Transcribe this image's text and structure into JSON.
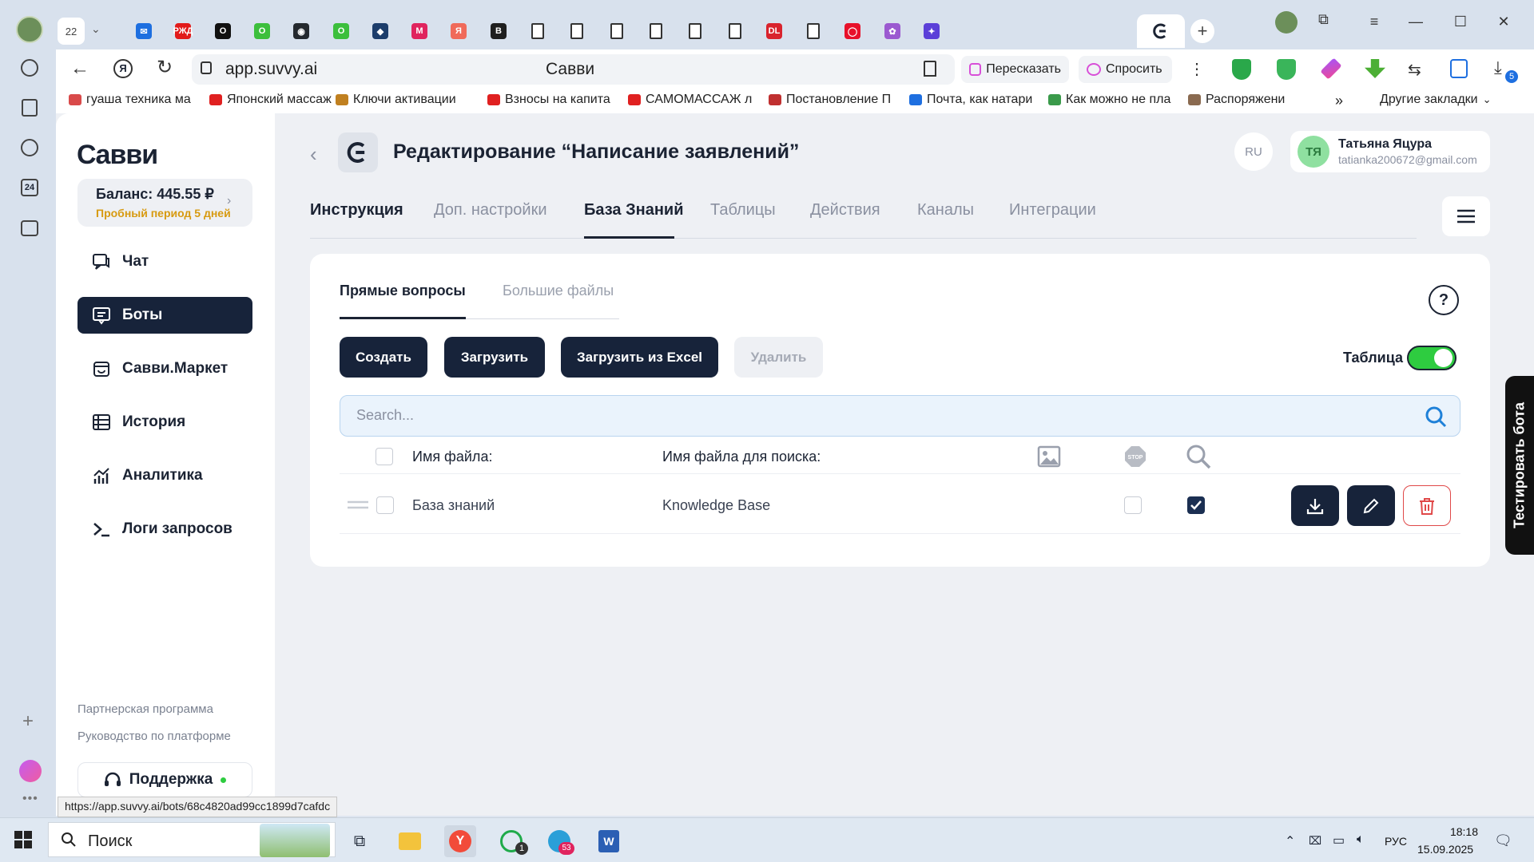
{
  "browser": {
    "tab_count": "22",
    "url": "app.suvvy.ai",
    "page_title": "Савви",
    "retell_label": "Пересказать",
    "ask_label": "Спросить",
    "download_badge": "5",
    "status_url": "https://app.suvvy.ai/bots/68c4820ad99cc1899d7cafdc",
    "bookmarks": [
      "гуаша техника ма",
      "Японский массаж",
      "Ключи активации",
      "Взносы на капита",
      "САМОМАССАЖ л",
      "Постановление П",
      "Почта, как натари",
      "Как можно не пла",
      "Распоряжени"
    ],
    "other_bookmarks": "Другие закладки",
    "tab_icons": [
      {
        "name": "mail",
        "color": "#1e6fe0",
        "glyph": "✉"
      },
      {
        "name": "rzd",
        "color": "#e21a1a",
        "glyph": "РЖД"
      },
      {
        "name": "o-dark",
        "color": "#111111",
        "glyph": "O"
      },
      {
        "name": "o-green",
        "color": "#3cbf3c",
        "glyph": "O"
      },
      {
        "name": "github",
        "color": "#24292e",
        "glyph": "◉"
      },
      {
        "name": "o-green2",
        "color": "#3cbf3c",
        "glyph": "O"
      },
      {
        "name": "game",
        "color": "#1c3d6b",
        "glyph": "◆"
      },
      {
        "name": "m-red",
        "color": "#e0245e",
        "glyph": "M"
      },
      {
        "name": "yandex-tab",
        "color": "#f06a5a",
        "glyph": "Я"
      },
      {
        "name": "b-tab",
        "color": "#1f1f1f",
        "glyph": "B"
      },
      {
        "name": "doc1",
        "color": "#ffffff",
        "glyph": ""
      },
      {
        "name": "doc2",
        "color": "#ffffff",
        "glyph": ""
      },
      {
        "name": "doc3",
        "color": "#ffffff",
        "glyph": ""
      },
      {
        "name": "doc4",
        "color": "#ffffff",
        "glyph": ""
      },
      {
        "name": "doc5",
        "color": "#ffffff",
        "glyph": ""
      },
      {
        "name": "doc6",
        "color": "#ffffff",
        "glyph": ""
      },
      {
        "name": "dl",
        "color": "#d9232d",
        "glyph": "DL"
      },
      {
        "name": "doc7",
        "color": "#ffffff",
        "glyph": ""
      },
      {
        "name": "opera",
        "color": "#e8102a",
        "glyph": "◯"
      },
      {
        "name": "figma",
        "color": "#9b59d0",
        "glyph": "✿"
      },
      {
        "name": "star",
        "color": "#5b3fd8",
        "glyph": "✦"
      }
    ]
  },
  "app": {
    "logo": "Cавви",
    "balance": "Баланс: 445.55 ₽",
    "trial": "Пробный период 5 дней",
    "nav": [
      "Чат",
      "Боты",
      "Савви.Маркет",
      "История",
      "Аналитика",
      "Логи запросов"
    ],
    "partner_link": "Партнерская программа",
    "guide_link": "Руководство по платформе",
    "support": "Поддержка",
    "title": "Редактирование “Написание заявлений”",
    "lang": "RU",
    "user": {
      "initials": "ТЯ",
      "name": "Татьяна Яцура",
      "email": "tatianka200672@gmail.com"
    },
    "main_tabs": [
      "Инструкция",
      "Доп. настройки",
      "База Знаний",
      "Таблицы",
      "Действия",
      "Каналы",
      "Интеграции"
    ],
    "sub_tabs": [
      "Прямые вопросы",
      "Большие файлы"
    ],
    "help": "?",
    "buttons": {
      "create": "Создать",
      "upload": "Загрузить",
      "upload_excel": "Загрузить из Excel",
      "delete": "Удалить"
    },
    "table_toggle_label": "Таблица",
    "table_toggle_on": true,
    "search_placeholder": "Search...",
    "columns": {
      "file_name": "Имя файла:",
      "search_name": "Имя файла для поиска:"
    },
    "rows": [
      {
        "file_name": "База знаний",
        "search_name": "Knowledge Base",
        "stop": false,
        "search": true
      }
    ],
    "test_bot": "Тестировать бота"
  },
  "taskbar": {
    "search": "Поиск",
    "whatsapp_badge": "1",
    "telegram_badge": "53",
    "lang": "РУС",
    "time": "18:18",
    "date": "15.09.2025"
  },
  "colors": {
    "accent": "#17233a",
    "toggle_on": "#2ecc40",
    "trial": "#d79a10",
    "delete": "#e04848"
  }
}
